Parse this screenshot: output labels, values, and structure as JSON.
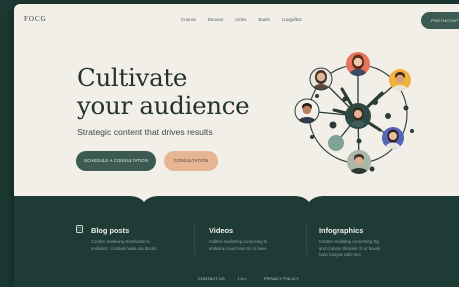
{
  "nav": {
    "logo": "FOCG",
    "links": [
      "Cuonra",
      "Deouns",
      "Ucles",
      "Buels",
      "Lungufbxt"
    ],
    "cta": "PGETNCONT"
  },
  "hero": {
    "title_line1": "Cultivate",
    "title_line2": "your audience",
    "subtitle": "Strategic content that drives results",
    "primary_button": "SCHEDULE A CONSULTATION",
    "secondary_button": "CONSULTATION"
  },
  "cards": [
    {
      "title": "Blog posts",
      "icon": "shield-icon",
      "line1": "Contem markuing stomilution tu",
      "line2": "endiseirs. ccottival heals ara dooda"
    },
    {
      "title": "Videos",
      "line1": "Culltivs marketing ccrnurcing to",
      "line2": "endutine cous hous tor ro bees."
    },
    {
      "title": "Infographics",
      "line1": "Contem markting connesting thy",
      "line2": "and cruturer thinkalo ch ur buvalr",
      "line3": "hanc booyas calie rten"
    }
  ],
  "footer": {
    "contact": "CONTACT US",
    "social": "f  in  t",
    "privacy": "PRIVACY POLICY"
  },
  "colors": {
    "background": "#1f3b35",
    "hero_bg": "#f1efe8",
    "primary": "#3b5a52",
    "accent": "#e7b494",
    "hub": "#2c4a43"
  }
}
